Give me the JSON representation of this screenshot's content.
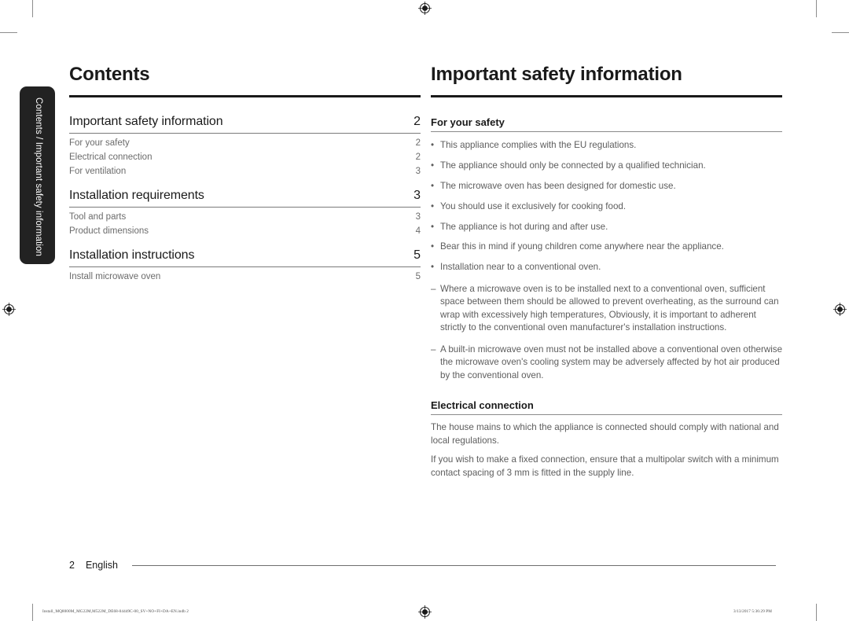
{
  "side_tab": {
    "label": "Contents / Important safety information"
  },
  "left_column": {
    "title": "Contents",
    "toc": [
      {
        "label": "Important safety information",
        "page": "2",
        "sub": [
          {
            "label": "For your safety",
            "page": "2"
          },
          {
            "label": "Electrical connection",
            "page": "2"
          },
          {
            "label": "For ventilation",
            "page": "3"
          }
        ]
      },
      {
        "label": "Installation requirements",
        "page": "3",
        "sub": [
          {
            "label": "Tool and parts",
            "page": "3"
          },
          {
            "label": "Product dimensions",
            "page": "4"
          }
        ]
      },
      {
        "label": "Installation instructions",
        "page": "5",
        "sub": [
          {
            "label": "Install microwave oven",
            "page": "5"
          }
        ]
      }
    ]
  },
  "right_column": {
    "title": "Important safety information",
    "sections": [
      {
        "heading": "For your safety",
        "bullets": [
          "This appliance complies with the EU regulations.",
          "The appliance should only be connected by a qualified technician.",
          "The microwave oven has been designed for domestic use.",
          "You should use it exclusively for cooking food.",
          "The appliance is hot during and after use.",
          "Bear this in mind if young children come anywhere near the appliance.",
          "Installation near to a conventional oven."
        ],
        "dashes": [
          "Where a microwave oven is to be installed next to a conventional oven, sufficient space between them should be allowed to prevent overheating, as the surround can wrap with excessively high temperatures, Obviously, it is important to adherent strictly to the conventional oven manufacturer's installation instructions.",
          "A built-in microwave oven must not be installed above a conventional oven otherwise the microwave oven's cooling system may be adversely affected by hot air produced by the conventional oven."
        ]
      },
      {
        "heading": "Electrical connection",
        "paragraphs": [
          "The house mains to which the appliance is connected should comply with national and local regulations.",
          "If you wish to make a fixed connection, ensure that a multipolar switch with a minimum contact spacing of 3 mm is fitted in the supply line."
        ]
      }
    ]
  },
  "footer": {
    "page_number": "2",
    "language": "English",
    "print_file": "Install_MQ8000M_MG22M,M522M_DE68-04449C-00_SV+NO+FI+DA+EN.indb   2",
    "print_timestamp": "3/13/2017   5:36:29 PM"
  },
  "marks": {
    "bullet_glyph": "•",
    "dash_glyph": "–"
  }
}
